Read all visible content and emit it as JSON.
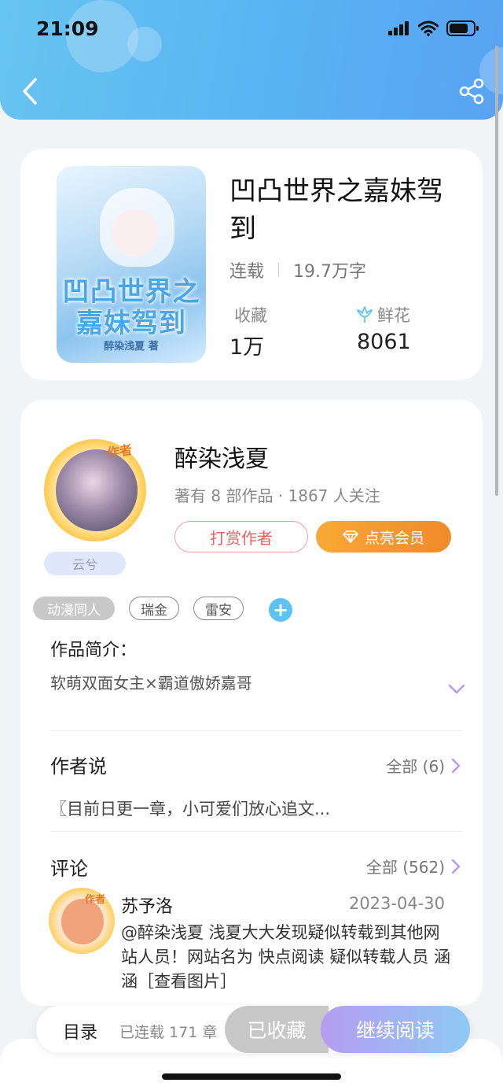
{
  "status_bar": {
    "time": "21:09"
  },
  "book": {
    "title": "凹凸世界之嘉妹驾到",
    "status": "连载",
    "word_count": "19.7万字",
    "favorites_label": "收藏",
    "favorites_value": "1万",
    "flowers_label": "鲜花",
    "flowers_value": "8061",
    "cover_title": "凹凸世界之嘉妹驾到",
    "cover_author": "醉染浅夏 著"
  },
  "author": {
    "avatar_tag": "作者",
    "badge": "云兮",
    "name": "醉染浅夏",
    "meta": "著有 8 部作品 · 1867 人关注",
    "reward_label": "打赏作者",
    "vip_label": "点亮会员"
  },
  "tags": [
    "动漫同人",
    "瑞金",
    "雷安"
  ],
  "intro": {
    "title": "作品简介：",
    "text": "软萌双面女主×霸道傲娇嘉哥"
  },
  "author_says": {
    "title": "作者说",
    "more": "全部 (6)",
    "text": "〖目前日更一章，小可爱们放心追文..."
  },
  "comments": {
    "title": "评论",
    "more": "全部 (562)",
    "items": [
      {
        "avatar_tag": "作者",
        "name": "苏予洛",
        "date": "2023-04-30",
        "text": "@醉染浅夏 浅夏大大发现疑似转载到其他网站人员！网站名为 快点阅读 疑似转载人员 涵涵［查看图片］"
      }
    ]
  },
  "bottom_bar": {
    "toc_label": "目录",
    "toc_sub": "已连载 171 章",
    "collected_label": "已收藏",
    "read_label": "继续阅读"
  },
  "colors": {
    "header_gradient_start": "#68c4f0",
    "header_gradient_end": "#58a3f2",
    "vip_orange": "#f9a935",
    "reward_red": "#e46262",
    "tag_add_blue": "#5ec3f2",
    "read_gradient_start": "#b69cf0",
    "read_gradient_end": "#8ec9f5"
  }
}
